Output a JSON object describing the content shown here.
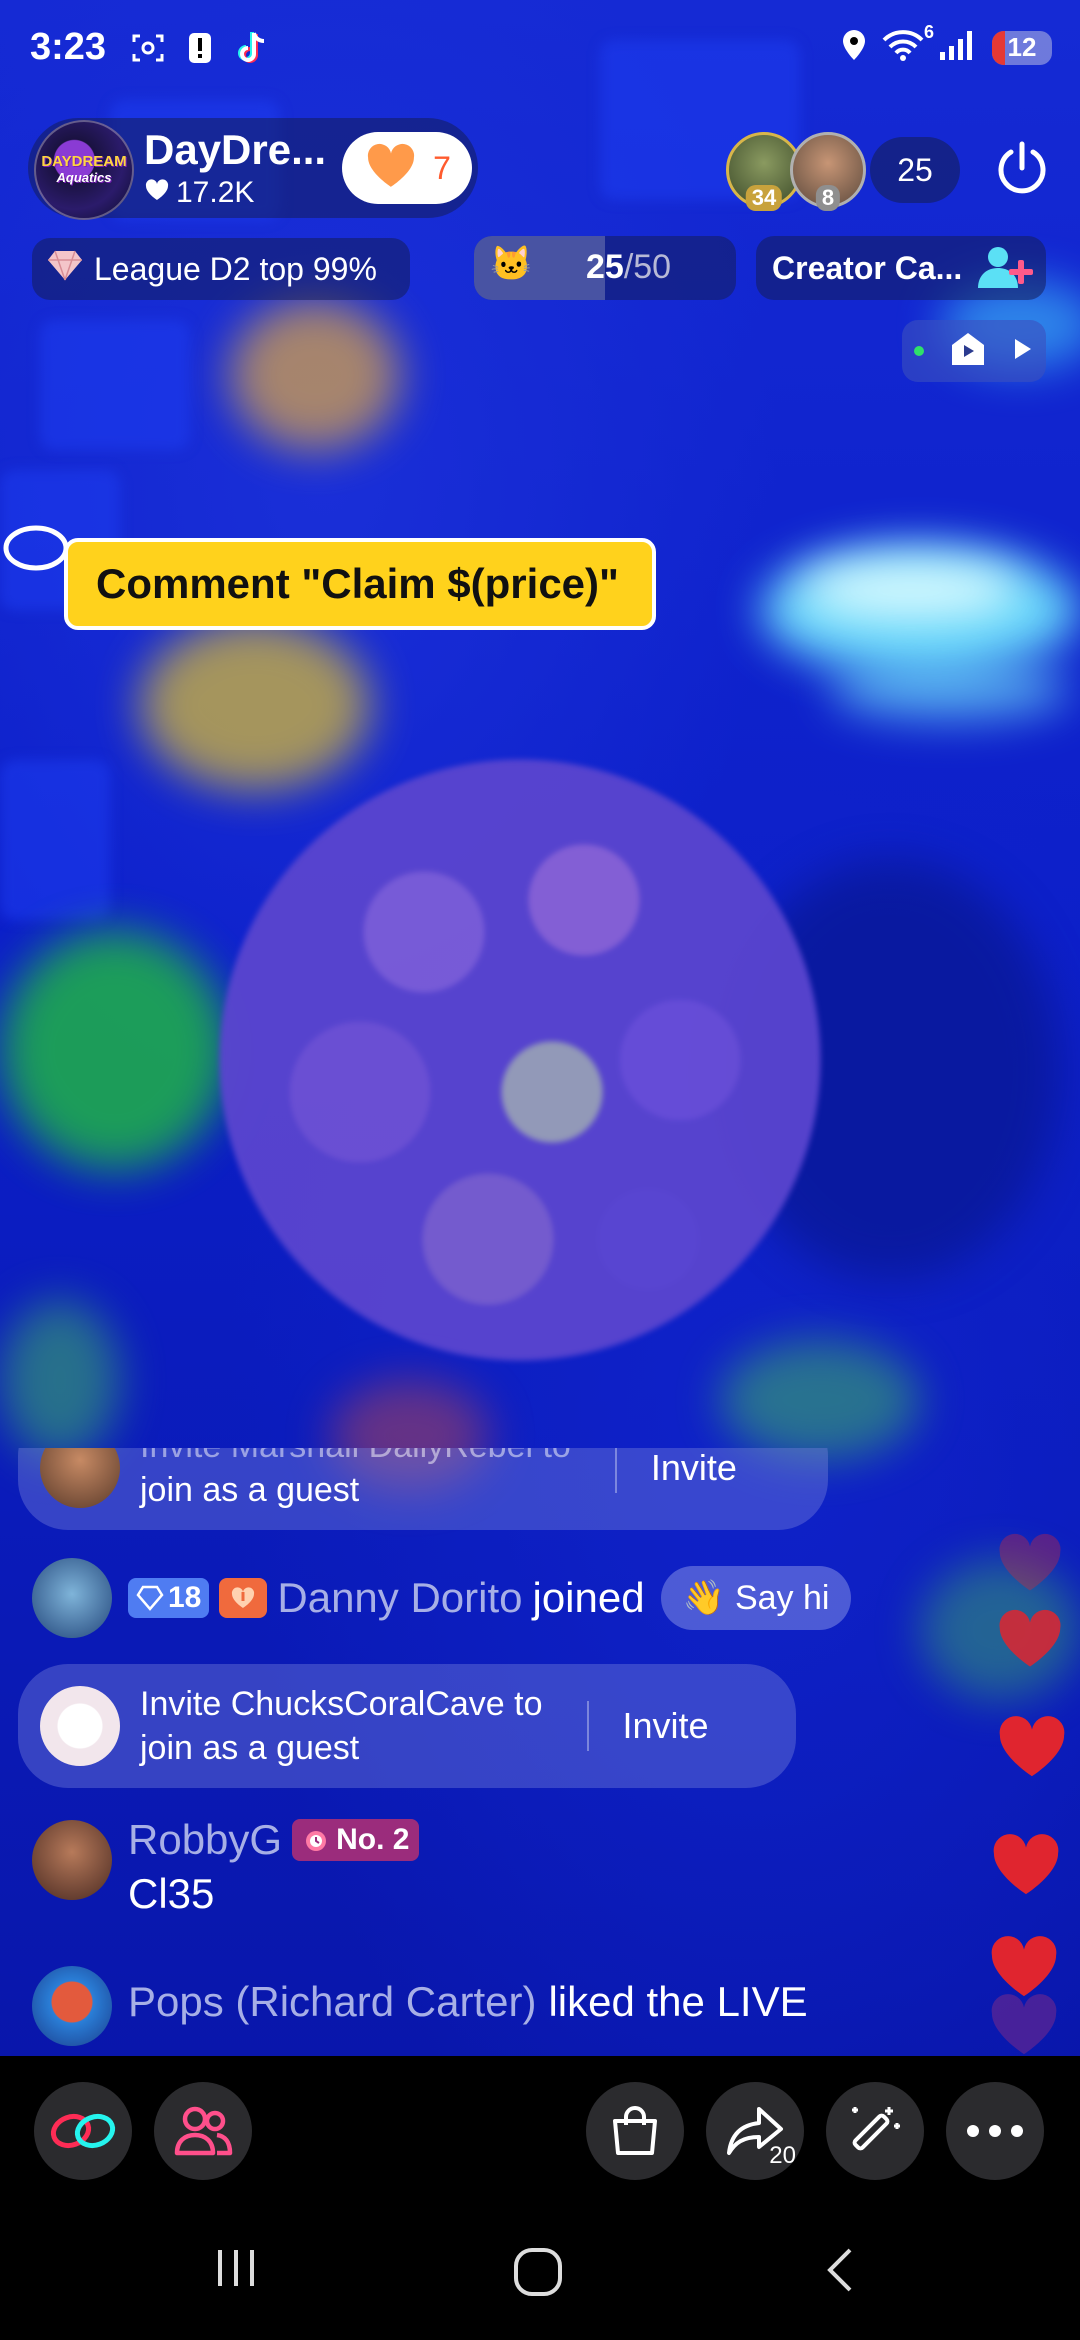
{
  "status_bar": {
    "time": "3:23",
    "wifi_badge": "6",
    "battery": "12",
    "icons": [
      "screenshot-icon",
      "alert-icon",
      "tiktok-icon",
      "location-icon",
      "wifi-icon",
      "signal-icon",
      "battery-icon"
    ]
  },
  "host": {
    "name": "DayDre...",
    "likes": "17.2K",
    "logo_text": "DAYDREAM",
    "logo_sub": "Aquatics",
    "heart_count": "7"
  },
  "viewers": {
    "top1_badge": "34",
    "top2_badge": "8",
    "count": "25"
  },
  "info": {
    "league": "League D2 top 99%",
    "goal_current": "25",
    "goal_total": "/50",
    "goal_progress": 0.5,
    "creator": "Creator Ca..."
  },
  "claim_tag": {
    "text": "Comment \"Claim $(price)\""
  },
  "chat": [
    {
      "type": "guest_invite",
      "line1": "Invite Marshall DailyRebel to",
      "line2": "join as a guest",
      "action": "Invite"
    },
    {
      "type": "joined",
      "level": "18",
      "user": "Danny Dorito",
      "text": "joined",
      "action": "Say hi"
    },
    {
      "type": "guest_invite",
      "line1": "Invite ChucksCoralCave to",
      "line2": "join as a guest",
      "action": "Invite"
    },
    {
      "type": "comment",
      "user": "RobbyG",
      "badge": "No. 2",
      "text": "Cl35"
    },
    {
      "type": "like",
      "user": "Pops (Richard Carter)",
      "text": "liked the LIVE"
    }
  ],
  "toolbar": {
    "buttons": [
      "link-icon",
      "guests-icon",
      "shop-icon",
      "share-icon",
      "magic-icon",
      "more-icon"
    ],
    "share_count": "20"
  },
  "colors": {
    "accent_pink": "#fe2c55",
    "accent_cyan": "#25f4ee",
    "claim_yellow": "#ffd21c",
    "heart_red": "#e0252f",
    "username": "#a7afe6"
  }
}
